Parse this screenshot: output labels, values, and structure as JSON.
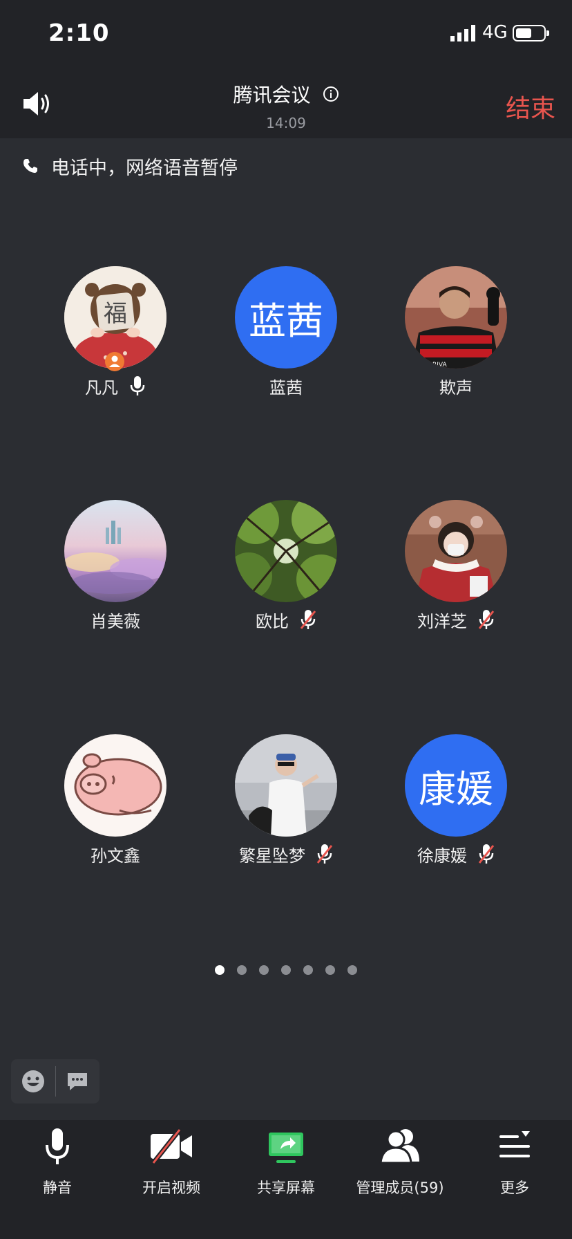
{
  "status": {
    "time": "2:10",
    "network": "4G"
  },
  "header": {
    "title": "腾讯会议",
    "clock": "14:09",
    "end_label": "结束"
  },
  "notice": {
    "text": "电话中，网络语音暂停"
  },
  "participants": [
    {
      "name": "凡凡",
      "mic": "on",
      "host": true
    },
    {
      "name": "蓝茜",
      "avatar_text": "蓝茜",
      "avatar_color": "#2f6ef2"
    },
    {
      "name": "欺声"
    },
    {
      "name": "肖美薇"
    },
    {
      "name": "欧比",
      "mic": "muted"
    },
    {
      "name": "刘洋芝",
      "mic": "muted"
    },
    {
      "name": "孙文鑫"
    },
    {
      "name": "繁星坠梦",
      "mic": "muted"
    },
    {
      "name": "徐康媛",
      "mic": "muted",
      "avatar_text": "康媛",
      "avatar_color": "#2f6ef2"
    }
  ],
  "pagination": {
    "current": 1,
    "total": 7
  },
  "toolbar": {
    "mute": "静音",
    "video": "开启视频",
    "share": "共享屏幕",
    "members": "管理成员(59)",
    "more": "更多"
  },
  "colors": {
    "accent": "#2f6ef2",
    "end": "#e8554e",
    "share_green": "#2fc65e"
  }
}
